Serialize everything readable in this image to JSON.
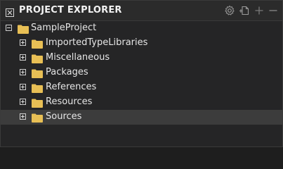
{
  "panel": {
    "title": "PROJECT EXPLORER"
  },
  "toolbar": {
    "settings_icon": "gear-icon",
    "new_file_icon": "new-file-icon",
    "add_icon": "plus-icon",
    "collapse_icon": "minus-icon"
  },
  "tree": {
    "root": {
      "label": "SampleProject",
      "expanded": true
    },
    "children": [
      {
        "label": "ImportedTypeLibraries",
        "expanded": false
      },
      {
        "label": "Miscellaneous",
        "expanded": false
      },
      {
        "label": "Packages",
        "expanded": false
      },
      {
        "label": "References",
        "expanded": false
      },
      {
        "label": "Resources",
        "expanded": false
      },
      {
        "label": "Sources",
        "expanded": false,
        "selected": true
      }
    ]
  },
  "colors": {
    "folder": "#e8bf55",
    "selection": "#3c3c3c",
    "background": "#252526"
  }
}
